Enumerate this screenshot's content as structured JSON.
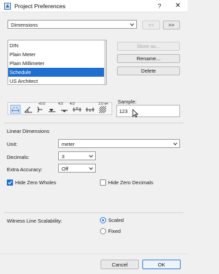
{
  "window": {
    "title": "Project Preferences",
    "help": "?",
    "close": "✕"
  },
  "category": {
    "value": "Dimensions",
    "prev": "<<",
    "next": ">>"
  },
  "presets": {
    "items": [
      "DIN",
      "Plain Meter",
      "Plain Millimeter",
      "Schedule",
      "US Architect"
    ],
    "selected_index": 3
  },
  "actions": {
    "store_as": "Store as...",
    "rename": "Rename...",
    "delete": "Delete"
  },
  "sample": {
    "label": "Sample:",
    "value": "123"
  },
  "icon_toolbar": {
    "icons": [
      "linear-dimension-icon",
      "angle-dimension-icon",
      "radial-dimension-icon",
      "level-dimension-icon",
      "elevation-dimension-icon",
      "door-window-dimension-icon",
      "sill-height-dimension-icon",
      "area-calculation-icon"
    ],
    "selected_index": 0,
    "superscripts": [
      "",
      "",
      "+0.0",
      "4.0",
      "4.0",
      "",
      "",
      "2.0 m²"
    ]
  },
  "linear": {
    "heading": "Linear Dimensions",
    "unit_label": "Unit:",
    "unit_value": "meter",
    "decimals_label": "Decimals:",
    "decimals_value": "3",
    "extra_label": "Extra Accuracy:",
    "extra_value": "Off",
    "hide_zero_wholes": {
      "label": "Hide Zero Wholes",
      "checked": true
    },
    "hide_zero_decimals": {
      "label": "Hide Zero Decimals",
      "checked": false
    }
  },
  "witness": {
    "label": "Witness Line Scalability:",
    "options": [
      {
        "label": "Scaled",
        "selected": true
      },
      {
        "label": "Fixed",
        "selected": false
      }
    ]
  },
  "footer": {
    "cancel": "Cancel",
    "ok": "OK"
  },
  "colors": {
    "accent": "#1f6fd0",
    "background": "#f0f0f0"
  }
}
